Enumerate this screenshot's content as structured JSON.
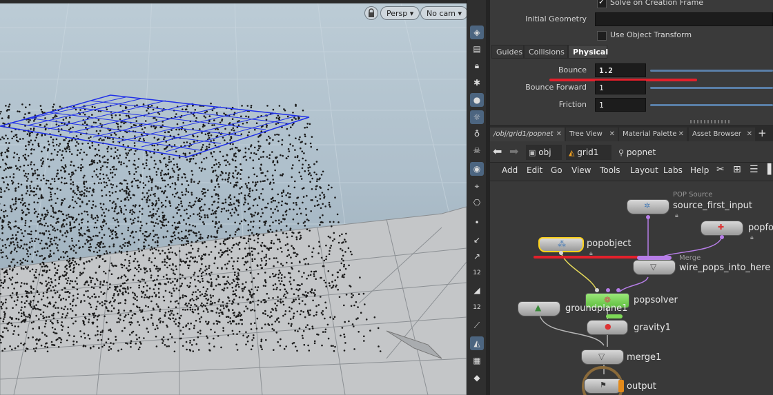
{
  "viewport": {
    "persp_label": "Persp ▾",
    "cam_label": "No cam ▾",
    "lock_icon": "lock-icon"
  },
  "toolbar": {
    "badge_12a": "12",
    "badge_12b": "12"
  },
  "params": {
    "solve_on_creation_frame": "Solve on Creation Frame",
    "initial_geometry_label": "Initial Geometry",
    "use_object_transform": "Use Object Transform",
    "tabs": [
      "Guides",
      "Collisions",
      "Physical"
    ],
    "bounce_label": "Bounce",
    "bounce_value": "1.2",
    "bounce_forward_label": "Bounce Forward",
    "bounce_forward_value": "1",
    "friction_label": "Friction",
    "friction_value": "1"
  },
  "pane_tabs": [
    "/obj/grid1/popnet",
    "Tree View",
    "Material Palette",
    "Asset Browser"
  ],
  "path": {
    "obj": "obj",
    "grid1": "grid1",
    "popnet": "popnet"
  },
  "menu": [
    "Add",
    "Edit",
    "Go",
    "View",
    "Tools",
    "Layout",
    "Labs",
    "Help"
  ],
  "network": {
    "nodes": {
      "source_type": "POP Source",
      "source": "source_first_input",
      "popforce": "popfo",
      "popobject": "popobject",
      "merge_type": "Merge",
      "merge": "wire_pops_into_here",
      "popsolver": "popsolver",
      "groundplane": "groundplane1",
      "gravity": "gravity1",
      "merge1": "merge1",
      "output": "output"
    }
  },
  "colors": {
    "selection_yellow": "#ffd21a",
    "solver_green": "#7ed957",
    "annotation_red": "#e3202b",
    "wire_purple": "#b77ee8",
    "wire_yellow": "#e3d85a",
    "grid_blue": "#1f2fe8"
  }
}
